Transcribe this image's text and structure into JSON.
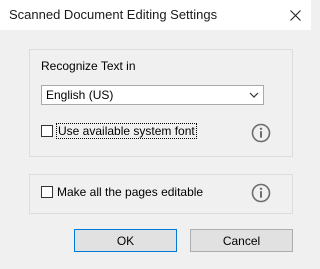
{
  "dialog": {
    "title": "Scanned Document Editing Settings"
  },
  "recognize": {
    "label": "Recognize Text in",
    "language_value": "English (US)",
    "use_system_font_label": "Use available system font",
    "use_system_font_checked": false
  },
  "editable": {
    "make_all_pages_label": "Make all the pages editable",
    "make_all_pages_checked": false
  },
  "buttons": {
    "ok": "OK",
    "cancel": "Cancel"
  },
  "icons": {
    "close": "close-icon",
    "dropdown": "chevron-down-icon",
    "info": "info-icon"
  }
}
